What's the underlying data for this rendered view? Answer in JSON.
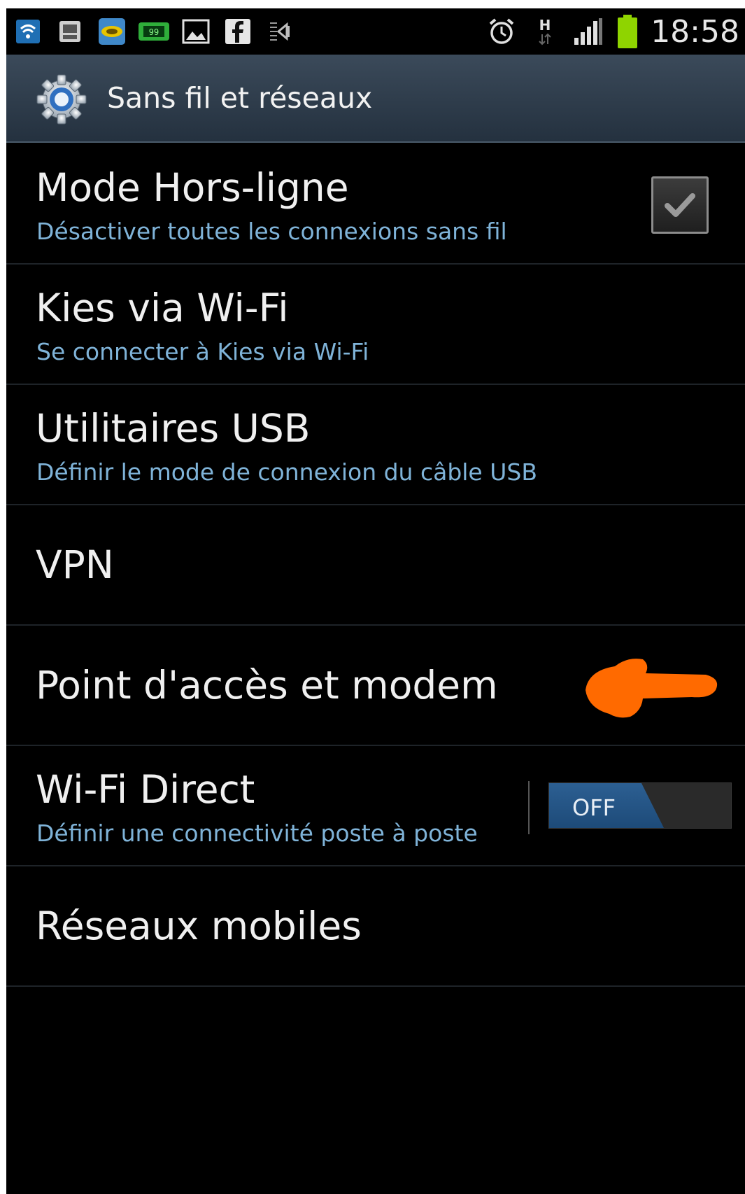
{
  "status_bar": {
    "time": "18:58",
    "notification_icons": [
      "wifi-icon",
      "sim-3g-icon",
      "app-icon",
      "battery-99-icon",
      "picture-icon",
      "facebook-icon",
      "usb-debug-icon"
    ],
    "system_icons": [
      "alarm-icon",
      "hsdpa-icon",
      "signal-icon",
      "battery-icon"
    ],
    "signal_bars_accent": "#ffffff",
    "battery_color": "#8fd400"
  },
  "action_bar": {
    "title": "Sans fil et réseaux",
    "icon": "settings-gear-icon"
  },
  "settings": {
    "airplane_mode": {
      "title": "Mode Hors-ligne",
      "subtitle": "Désactiver toutes les connexions sans fil",
      "checked": true
    },
    "kies_wifi": {
      "title": "Kies via Wi-Fi",
      "subtitle": "Se connecter à Kies via Wi-Fi"
    },
    "usb_utilities": {
      "title": "Utilitaires USB",
      "subtitle": "Définir le mode de connexion du câble USB"
    },
    "vpn": {
      "title": "VPN"
    },
    "hotspot": {
      "title": "Point d'accès et modem",
      "annotation": "orange-arrow-icon"
    },
    "wifi_direct": {
      "title": "Wi-Fi Direct",
      "subtitle": "Définir une connectivité poste à poste",
      "toggle_label": "OFF"
    },
    "mobile_networks": {
      "title": "Réseaux mobiles"
    }
  },
  "colors": {
    "subtitle": "#7fb3d8",
    "toggle_blue": "#2c5f92",
    "annotation_orange": "#ff6a00"
  }
}
